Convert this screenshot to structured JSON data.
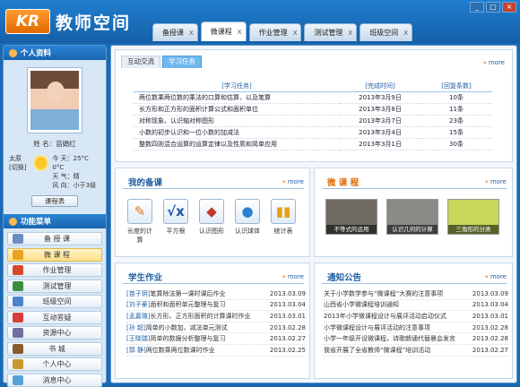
{
  "app": {
    "logo_text": "KR",
    "title": "教师空间"
  },
  "window_controls": [
    "_",
    "□",
    "×"
  ],
  "tabs": [
    {
      "label": "备授课",
      "close": "X"
    },
    {
      "label": "微课程",
      "close": "X",
      "active": true
    },
    {
      "label": "作业管理",
      "close": "X"
    },
    {
      "label": "测试管理",
      "close": "X"
    },
    {
      "label": "班级空间",
      "close": "X"
    }
  ],
  "profile": {
    "header": "个人资料",
    "name_label": "姓 名：",
    "name": "苗娟红",
    "city": "太原",
    "switch": "[切换]",
    "today_label": "今 天：",
    "today_value": "25°C 0°C",
    "weather_label": "天 气：",
    "weather_value": "晴",
    "wind_label": "风 向：",
    "wind_value": "小于3级",
    "courses_button": "课程表"
  },
  "function_menu": {
    "header": "功能菜单",
    "items": [
      {
        "label": "备 授 课",
        "icon": "book-icon",
        "color": "#6b8dc4"
      },
      {
        "label": "微 课 程",
        "icon": "video-icon",
        "color": "#e9a21f",
        "active": true
      },
      {
        "label": "作业管理",
        "icon": "pencil-icon",
        "color": "#d9482a"
      },
      {
        "label": "测试管理",
        "icon": "test-icon",
        "color": "#3d8f3d"
      },
      {
        "label": "班级空间",
        "icon": "class-icon",
        "color": "#4a83cc"
      },
      {
        "label": "互动答疑",
        "icon": "chat-icon",
        "color": "#d83d3d"
      },
      {
        "label": "资源中心",
        "icon": "resource-icon",
        "color": "#6f6f9e"
      },
      {
        "label": "书    城",
        "icon": "books-icon",
        "color": "#8b5a2b"
      },
      {
        "label": "个人中心",
        "icon": "user-icon",
        "color": "#c79a2b"
      },
      {
        "label": "消息中心",
        "icon": "message-icon",
        "color": "#5aa0d8"
      }
    ]
  },
  "tasks": {
    "tabs": [
      "互动交流",
      "学习任务"
    ],
    "more": "more",
    "headers": [
      "[学习任务]",
      "[完成时间]",
      "[回复条数]"
    ],
    "rows": [
      {
        "task": "两位数乘两位数的乘法的口算和估算、以及笔算",
        "date": "2013年3月9日",
        "count": "10条"
      },
      {
        "task": "长方形和正方形的面积计算公式和面积单位",
        "date": "2013年3月8日",
        "count": "11条"
      },
      {
        "task": "对称现象、认识轴对称图形",
        "date": "2013年3月7日",
        "count": "23条"
      },
      {
        "task": "小数的初步认识和一位小数的加减法",
        "date": "2013年3月4日",
        "count": "15条"
      },
      {
        "task": "整数四则混合运算的运算定律以及性质和简单应用",
        "date": "2013年3月1日",
        "count": "30条"
      }
    ]
  },
  "my_lessons": {
    "title": "我的备课",
    "more": "more",
    "tools": [
      {
        "label": "长度的计算",
        "icon": "ruler-icon",
        "glyph": "✎",
        "color": "#e07b1a"
      },
      {
        "label": "平方根",
        "icon": "sqrt-icon",
        "glyph": "√x",
        "color": "#2255aa"
      },
      {
        "label": "认识图形",
        "icon": "shapes-icon",
        "glyph": "◆",
        "color": "#c0392b"
      },
      {
        "label": "认识球体",
        "icon": "sphere-icon",
        "glyph": "●",
        "color": "#2a7fd4"
      },
      {
        "label": "统计表",
        "icon": "chart-icon",
        "glyph": "▮▮",
        "color": "#e3a21a"
      }
    ]
  },
  "micro_course": {
    "title": "微 课 程",
    "more": "more",
    "items": [
      {
        "caption": "不等式的运用",
        "color": "#6f6a62"
      },
      {
        "caption": "认识几何的计算",
        "color": "#8c8a87"
      },
      {
        "caption": "三角形的分类",
        "color": "#c8d85a"
      }
    ]
  },
  "homework": {
    "title": "学生作业",
    "more": "more",
    "rows": [
      {
        "name": "[苗子玥]",
        "text": "笔算除法第一课时课后作业",
        "date": "2013.03.09"
      },
      {
        "name": "[刘子豪]",
        "text": "面积和面积单元整理与复习",
        "date": "2013.03.04"
      },
      {
        "name": "[孟嘉璐]",
        "text": "长方形、正方形面积的计算课时作业",
        "date": "2013.03.01"
      },
      {
        "name": "[孙  超]",
        "text": "简单的小数加、减法单元测试",
        "date": "2013.02.28"
      },
      {
        "name": "[王晓瑞]",
        "text": "简单的数据分析整理与复习",
        "date": "2013.02.27"
      },
      {
        "name": "[郭  静]",
        "text": "两位数乘两位数课时作业",
        "date": "2013.02.25"
      }
    ]
  },
  "notices": {
    "title": "通知公告",
    "more": "more",
    "rows": [
      {
        "text": "关于小学数学参与“微课程”大赛的注意事项",
        "date": "2013.03.09"
      },
      {
        "text": "山西省小学微课程培训通知",
        "date": "2013.03.04"
      },
      {
        "text": "2013年小学微课程设计与展评活动启动仪式",
        "date": "2013.03.01"
      },
      {
        "text": "小学微课程设计与展评活动的注意事项",
        "date": "2013.02.28"
      },
      {
        "text": "小学一年级开设微课程，诗歌朗诵代替晨会发言",
        "date": "2013.02.28"
      },
      {
        "text": "我省开展了全省教师“微课程”培训活动",
        "date": "2013.02.27"
      }
    ]
  }
}
